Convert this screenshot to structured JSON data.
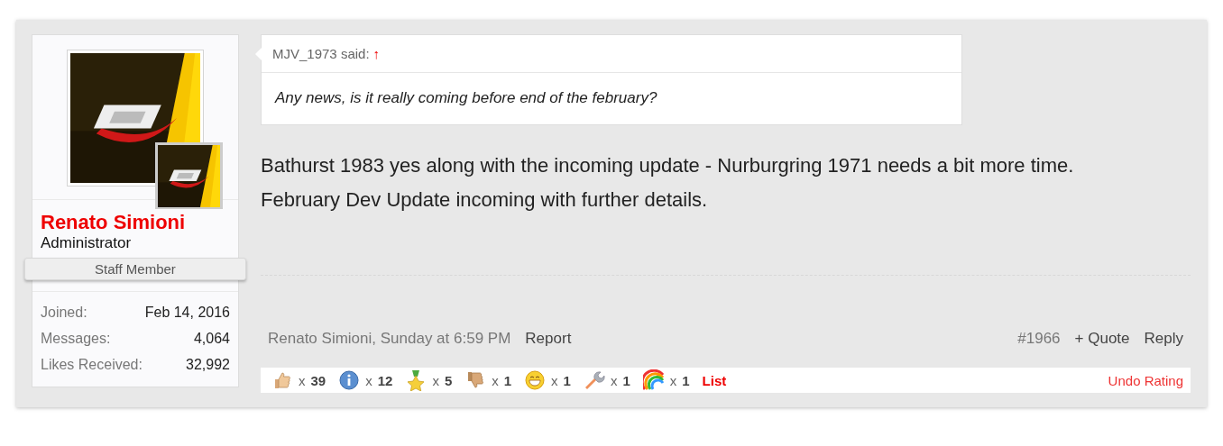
{
  "user": {
    "name": "Renato Simioni",
    "title": "Administrator",
    "banner": "Staff Member",
    "stats": [
      {
        "label": "Joined:",
        "value": "Feb 14, 2016"
      },
      {
        "label": "Messages:",
        "value": "4,064"
      },
      {
        "label": "Likes Received:",
        "value": "32,992"
      }
    ]
  },
  "quote": {
    "author": "MJV_1973 said:",
    "arrow": "↑",
    "text": "Any news, is it really coming before end of the february?"
  },
  "message": [
    "Bathurst 1983 yes along with the incoming update - Nurburgring 1971 needs a bit more time.",
    "February Dev Update incoming with further details."
  ],
  "footer": {
    "byline": "Renato Simioni, Sunday at 6:59 PM",
    "report": "Report",
    "number": "#1966",
    "quote": "+ Quote",
    "reply": "Reply"
  },
  "ratings": [
    {
      "kind": "thumbs-up",
      "times": "x",
      "count": "39"
    },
    {
      "kind": "info",
      "times": "x",
      "count": "12"
    },
    {
      "kind": "star",
      "times": "x",
      "count": "5"
    },
    {
      "kind": "thumbs-down",
      "times": "x",
      "count": "1"
    },
    {
      "kind": "smile",
      "times": "x",
      "count": "1"
    },
    {
      "kind": "wrench",
      "times": "x",
      "count": "1"
    },
    {
      "kind": "rainbow",
      "times": "x",
      "count": "1"
    }
  ],
  "ratings_list": "List",
  "undo": "Undo Rating"
}
